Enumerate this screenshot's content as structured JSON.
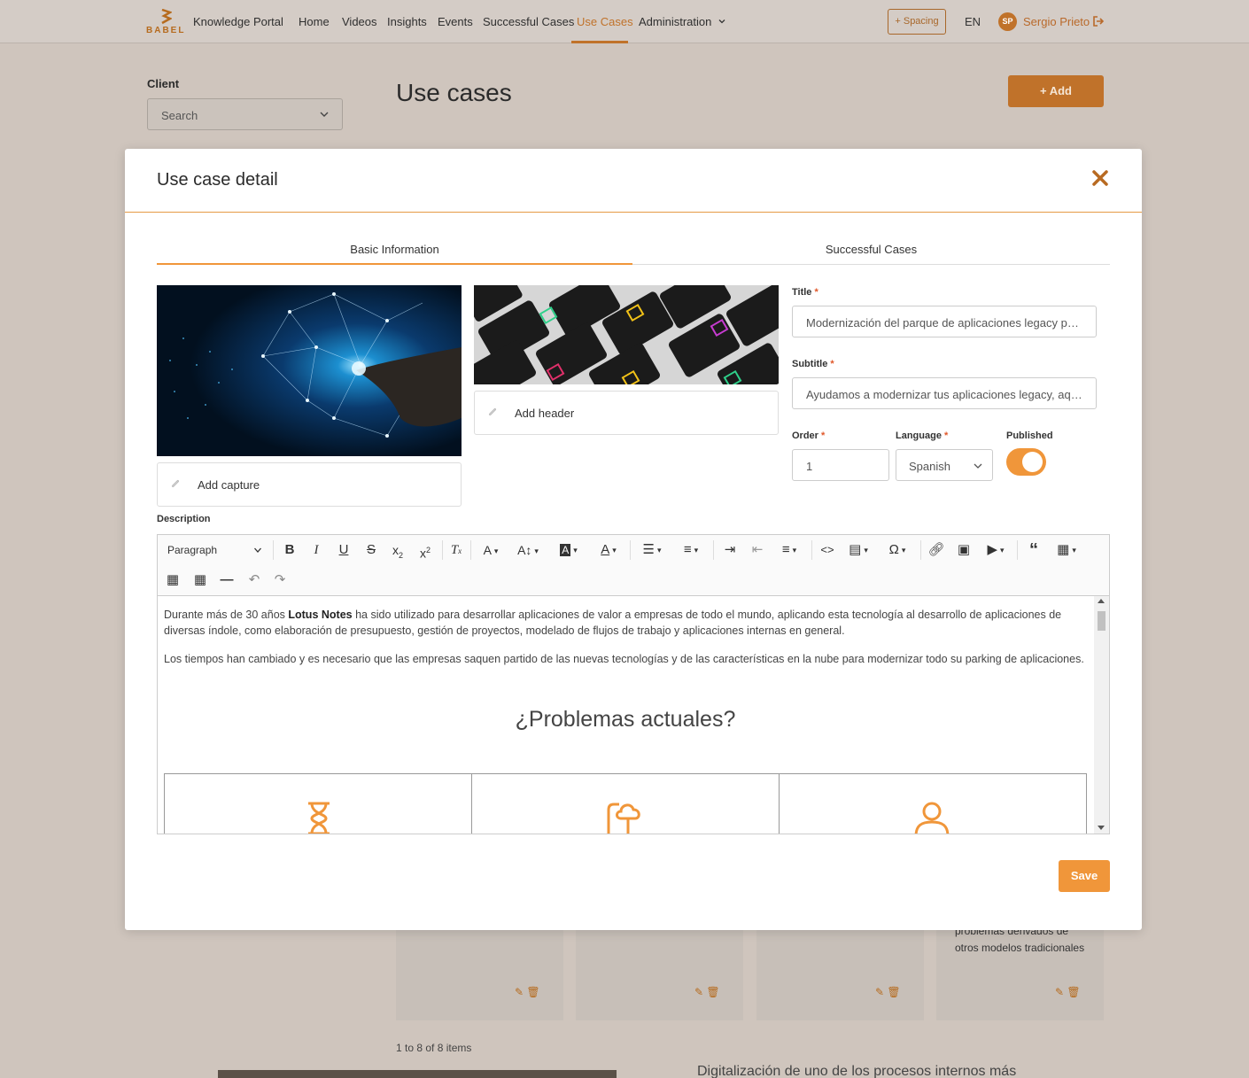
{
  "brand": {
    "logo_text": "BABEL",
    "portal_name": "Knowledge Portal",
    "accent": "#f0963a"
  },
  "nav": {
    "items": [
      {
        "label": "Home"
      },
      {
        "label": "Videos"
      },
      {
        "label": "Insights"
      },
      {
        "label": "Events"
      },
      {
        "label": "Successful Cases"
      },
      {
        "label": "Use Cases",
        "active": true
      },
      {
        "label": "Administration"
      }
    ],
    "spacing_button": "+ Spacing",
    "language": "EN",
    "user": {
      "initials": "SP",
      "name": "Sergio Prieto"
    }
  },
  "page": {
    "client_label": "Client",
    "client_placeholder": "Search",
    "title": "Use cases",
    "add_button": "+ Add",
    "card_text": "problemas derivados de otros modelos tradicionales",
    "pagination": "1 to 8 of 8 items",
    "below_text": "Digitalización de uno de los procesos internos más"
  },
  "modal": {
    "title": "Use case detail",
    "tabs": [
      {
        "label": "Basic Information",
        "active": true
      },
      {
        "label": "Successful Cases",
        "active": false
      }
    ],
    "add_capture": "Add capture",
    "add_header": "Add header",
    "fields": {
      "title_label": "Title",
      "title_value": "Modernización del parque de aplicaciones legacy para...",
      "subtitle_label": "Subtitle",
      "subtitle_value": "Ayudamos a modernizar tus aplicaciones legacy, aquel...",
      "order_label": "Order",
      "order_value": "1",
      "language_label": "Language",
      "language_value": "Spanish",
      "published_label": "Published",
      "published_value": true,
      "required_mark": "*"
    },
    "description_label": "Description",
    "editor": {
      "block_format": "Paragraph",
      "para1_before": "Durante más de 30 años ",
      "para1_bold": "Lotus Notes",
      "para1_after": " ha sido utilizado para desarrollar aplicaciones de valor a empresas de todo el mundo, aplicando esta tecnología al desarrollo de aplicaciones de diversas índole, como elaboración de presupuesto, gestión de proyectos, modelado de flujos de trabajo y aplicaciones internas en general.",
      "para2": "Los tiempos han cambiado y es necesario que las empresas saquen partido de las nuevas tecnologías y de las características en la nube para modernizar todo su parking de aplicaciones.",
      "heading": "¿Problemas actuales?",
      "problem_icons": [
        "hourglass-icon",
        "cloud-device-icon",
        "user-icon"
      ]
    },
    "save_button": "Save"
  }
}
